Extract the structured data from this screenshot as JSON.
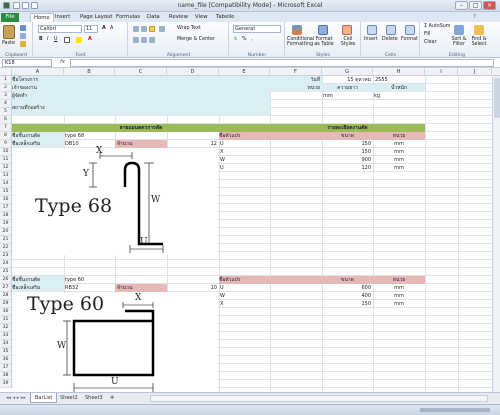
{
  "window": {
    "title": "name_file  [Compatibility Mode]  -  Microsoft Excel"
  },
  "tabs": [
    "File",
    "Home",
    "Insert",
    "Page Layout",
    "Formulas",
    "Data",
    "Review",
    "View",
    "Tabelle"
  ],
  "ribbon": {
    "paste": "Paste",
    "font_name": "Calibri",
    "font_size": "11",
    "wrap_text": "Wrap Text",
    "merge_center": "Merge & Center",
    "number_format": "General",
    "conditional_formatting": "Conditional Formatting",
    "format_as_table": "Format as Table",
    "cell_styles": "Cell Styles",
    "insert": "Insert",
    "delete": "Delete",
    "format": "Format",
    "autosum": "AutoSum",
    "fill": "Fill",
    "clear": "Clear",
    "sort_filter": "Sort & Filter",
    "find_select": "Find & Select",
    "groups": [
      "Clipboard",
      "Font",
      "Alignment",
      "Number",
      "Styles",
      "Cells",
      "Editing"
    ]
  },
  "formula_bar": {
    "name_box": "K18",
    "fx": "fx",
    "content": ""
  },
  "columns": [
    "A",
    "B",
    "C",
    "D",
    "E",
    "F",
    "G",
    "H",
    "I",
    "J"
  ],
  "rows": [
    "1",
    "2",
    "3",
    "4",
    "5",
    "6",
    "7",
    "8",
    "9",
    "10",
    "11",
    "12",
    "13",
    "14",
    "15",
    "16",
    "17",
    "18",
    "19",
    "20",
    "21",
    "22",
    "23",
    "24",
    "25",
    "26",
    "27",
    "28",
    "29",
    "30",
    "31",
    "32",
    "33",
    "34",
    "35",
    "36",
    "37",
    "38",
    "39"
  ],
  "cells": {
    "a1": "ชื่อโครงการ",
    "a2": "เจ้าของงาน",
    "a3": "ผู้จัดทำ",
    "a4": "สถานที่ก่อสร้าง",
    "f1": "วันที่",
    "g1": "15 ตุลาคม",
    "h1": "2555",
    "f2": "หน่วย",
    "g2": "ความยาว",
    "h2": "น้ำหนัก",
    "g3": "mm",
    "h3": "kg",
    "sec1_left": "ลายแผนดตวการตัด",
    "sec1_right": "รายละเอียดงานตัด",
    "a8": "ชื่อชิ้นงานตัด",
    "b8": "type 68",
    "f8": "ชื่อตัวแปร",
    "g8": "ขนาด",
    "h8": "หน่วย",
    "a9": "ชื่อเหล็กเสริม",
    "b9": "DB10",
    "c9": "จำนวน",
    "d9": "12",
    "f9": "U",
    "g9": "150",
    "h9": "mm",
    "f10": "X",
    "g10": "150",
    "h10": "mm",
    "f11": "W",
    "g11": "900",
    "h11": "mm",
    "f12": "U",
    "g12": "120",
    "h12": "mm",
    "type68_label": "Type 68",
    "a26": "ชื่อชิ้นงานตัด",
    "b26": "type 60",
    "f26": "ชื่อตัวแปร",
    "g26": "ขนาด",
    "h26": "หน่วย",
    "a27": "ชื่อเหล็กเสริม",
    "b27": "RB32",
    "c27": "จำนวน",
    "d27": "10",
    "f27": "U",
    "g27": "600",
    "h27": "mm",
    "f28": "W",
    "g28": "400",
    "h28": "mm",
    "f29": "X",
    "g29": "150",
    "h29": "mm",
    "type60_label": "Type 60",
    "dim_x": "X",
    "dim_y": "Y",
    "dim_w": "W",
    "dim_u": "U"
  },
  "sheets": [
    "BarList",
    "Sheet2",
    "Sheet3"
  ],
  "colors": {
    "header_blue": "#dbeef4",
    "section_green": "#9bbb59",
    "pink": "#e6b8b7",
    "light_pink": "#f2dcdb",
    "file_tab": "#2a8a3e"
  }
}
